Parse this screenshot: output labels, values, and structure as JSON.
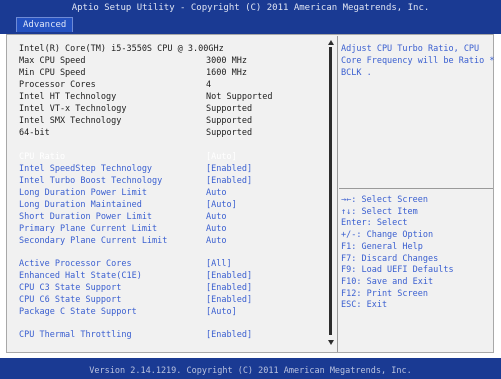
{
  "header": {
    "title": "Aptio Setup Utility - Copyright (C) 2011 American Megatrends, Inc.",
    "tab": "Advanced"
  },
  "info": [
    {
      "label": "Intel(R) Core(TM) i5-3550S CPU @ 3.00GHz",
      "value": ""
    },
    {
      "label": "Max CPU Speed",
      "value": "3000 MHz"
    },
    {
      "label": "Min CPU Speed",
      "value": "1600 MHz"
    },
    {
      "label": "Processor Cores",
      "value": "4"
    },
    {
      "label": "Intel HT Technology",
      "value": "Not Supported"
    },
    {
      "label": "Intel VT-x Technology",
      "value": "Supported"
    },
    {
      "label": "Intel SMX Technology",
      "value": "Supported"
    },
    {
      "label": "64-bit",
      "value": "Supported"
    }
  ],
  "settings1": [
    {
      "label": "CPU Ratio",
      "value": "[Auto]"
    },
    {
      "label": "Intel SpeedStep Technology",
      "value": "[Enabled]"
    },
    {
      "label": "Intel Turbo Boost Technology",
      "value": "[Enabled]"
    },
    {
      "label": "Long Duration Power Limit",
      "value": "Auto"
    },
    {
      "label": "Long Duration Maintained",
      "value": "[Auto]"
    },
    {
      "label": "Short Duration Power Limit",
      "value": "Auto"
    },
    {
      "label": "Primary Plane Current Limit",
      "value": "Auto"
    },
    {
      "label": "Secondary Plane Current Limit",
      "value": "Auto"
    }
  ],
  "settings2": [
    {
      "label": "Active Processor Cores",
      "value": "[All]"
    },
    {
      "label": "Enhanced Halt State(C1E)",
      "value": "[Enabled]"
    },
    {
      "label": "CPU C3 State Support",
      "value": "[Enabled]"
    },
    {
      "label": "CPU C6 State Support",
      "value": "[Enabled]"
    },
    {
      "label": "Package C State Support",
      "value": "[Auto]"
    }
  ],
  "settings3": [
    {
      "label": "CPU Thermal Throttling",
      "value": "[Enabled]"
    }
  ],
  "help": {
    "lines": [
      "Adjust CPU Turbo Ratio, CPU",
      "Core Frequency will be Ratio *",
      "BCLK ."
    ]
  },
  "keys": [
    "→←: Select Screen",
    "↑↓: Select Item",
    "Enter: Select",
    "+/-: Change Option",
    "F1: General Help",
    "F7: Discard Changes",
    "F9: Load UEFI Defaults",
    "F10: Save and Exit",
    "F12: Print Screen",
    "ESC: Exit"
  ],
  "footer": {
    "text": "Version 2.14.1219. Copyright (C) 2011 American Megatrends, Inc."
  },
  "colors": {
    "header_bg": "#1a3a93",
    "panel_bg": "#f1f1f1",
    "selected_text": "#ffffff",
    "option_text": "#3a5fd0",
    "static_text": "#1d1d1d"
  }
}
